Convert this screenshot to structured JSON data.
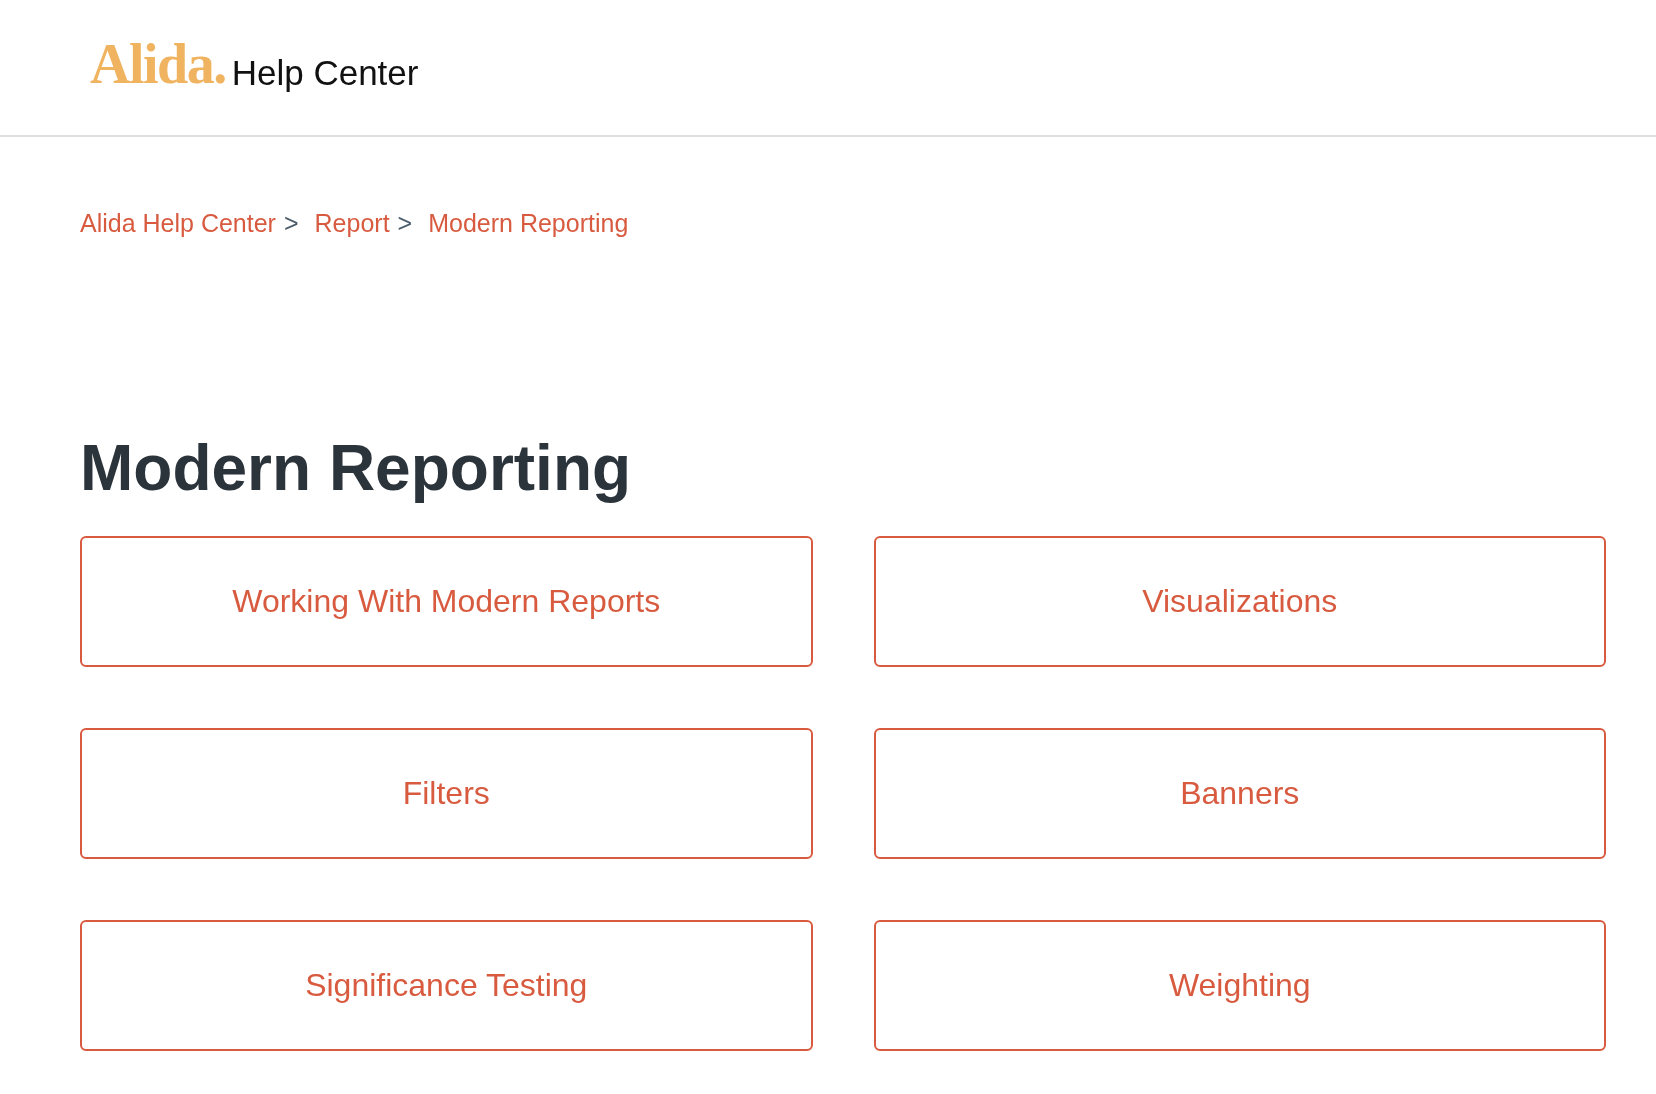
{
  "header": {
    "logo": "Alida.",
    "title": "Help Center"
  },
  "breadcrumb": [
    {
      "label": "Alida Help Center",
      "separator": ">"
    },
    {
      "label": "Report",
      "separator": ">"
    },
    {
      "label": "Modern Reporting"
    }
  ],
  "page_title": "Modern Reporting",
  "sections": [
    {
      "label": "Working With Modern Reports"
    },
    {
      "label": "Visualizations"
    },
    {
      "label": "Filters"
    },
    {
      "label": "Banners"
    },
    {
      "label": "Significance Testing"
    },
    {
      "label": "Weighting"
    }
  ]
}
